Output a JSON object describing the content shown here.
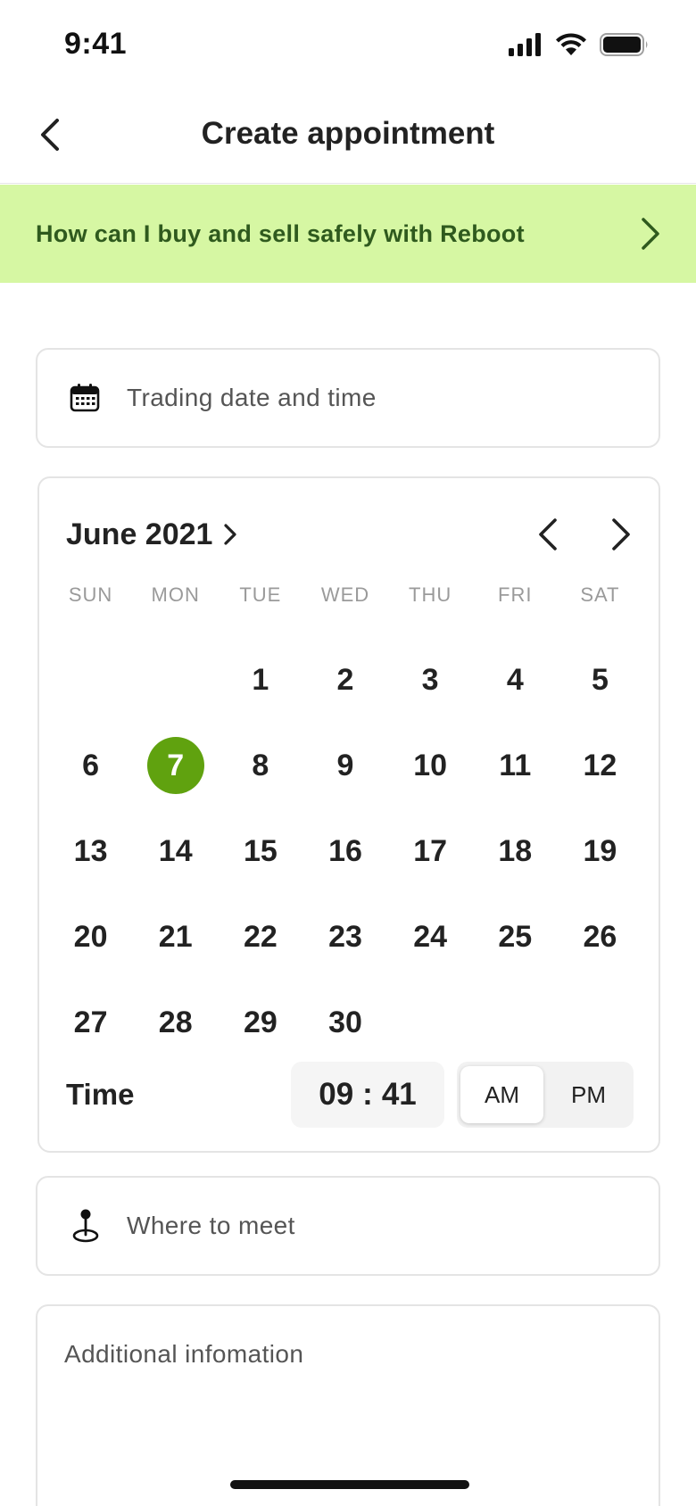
{
  "status_bar": {
    "time": "9:41"
  },
  "nav": {
    "title": "Create appointment"
  },
  "banner": {
    "text": "How can I buy and sell safely with Reboot"
  },
  "date_field": {
    "placeholder": "Trading date and time",
    "icon": "calendar-icon"
  },
  "calendar": {
    "month_label": "June 2021",
    "weekdays": [
      "SUN",
      "MON",
      "TUE",
      "WED",
      "THU",
      "FRI",
      "SAT"
    ],
    "leading_blanks": 2,
    "days": [
      "1",
      "2",
      "3",
      "4",
      "5",
      "6",
      "7",
      "8",
      "9",
      "10",
      "11",
      "12",
      "13",
      "14",
      "15",
      "16",
      "17",
      "18",
      "19",
      "20",
      "21",
      "22",
      "23",
      "24",
      "25",
      "26",
      "27",
      "28",
      "29",
      "30"
    ],
    "selected_day": "7",
    "selected_color": "#60a20f"
  },
  "time": {
    "label": "Time",
    "hour": "09",
    "separator": ":",
    "minute": "41",
    "am_label": "AM",
    "pm_label": "PM",
    "selected_period": "AM"
  },
  "meet_field": {
    "placeholder": "Where to meet",
    "icon": "location-pin-icon"
  },
  "info_field": {
    "placeholder": "Additional infomation"
  },
  "colors": {
    "banner_bg": "#d6f7a3",
    "banner_text": "#2f5a1e",
    "accent": "#60a20f"
  }
}
